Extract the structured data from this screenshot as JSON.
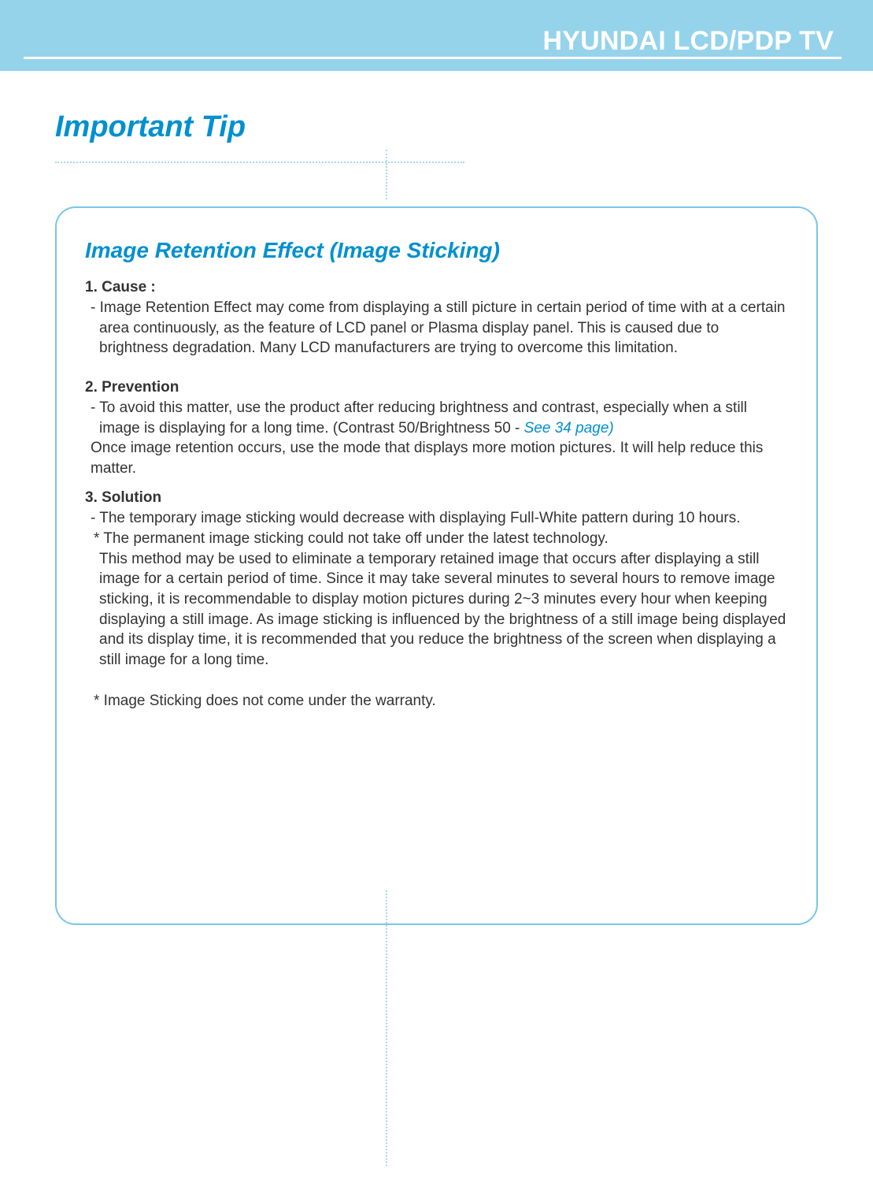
{
  "header": {
    "brand": "HYUNDAI LCD/PDP TV"
  },
  "tip": {
    "title": "Important Tip"
  },
  "box": {
    "heading": "Image Retention Effect (Image Sticking)",
    "s1_label": "1. Cause :",
    "s1_body": "-  Image Retention Effect may come from displaying a still picture in certain period of time with at a certain area continuously, as the feature of LCD panel or Plasma display panel. This is caused due to brightness degradation. Many LCD manufacturers are trying to overcome this limitation.",
    "s2_label": "2. Prevention",
    "s2_body_a": "- To avoid this matter, use the product after reducing brightness and contrast, especially when a still image is displaying for a long time. (Contrast 50/Brightness 50 - ",
    "s2_link": "See 34 page)",
    "s2_body_b": "Once image retention occurs, use the mode that displays more motion pictures. It will help reduce this matter.",
    "s3_label": "3. Solution",
    "s3_line1": "- The temporary image sticking would decrease with displaying Full-White pattern during 10 hours.",
    "s3_line2": "* The permanent image sticking could not take off under the latest technology.",
    "s3_para": "This method may be used to eliminate a temporary retained image that occurs after displaying a still image for a certain period of time. Since it may take several minutes to several hours to remove image sticking, it is recommendable to display motion pictures during 2~3 minutes every hour when keeping displaying a still image. As image sticking is influenced by the brightness of a still image being displayed and its display time, it is recommended that you reduce the brightness of the screen when displaying a still image for a long time.",
    "s3_warranty": "* Image Sticking does not come under the warranty."
  }
}
